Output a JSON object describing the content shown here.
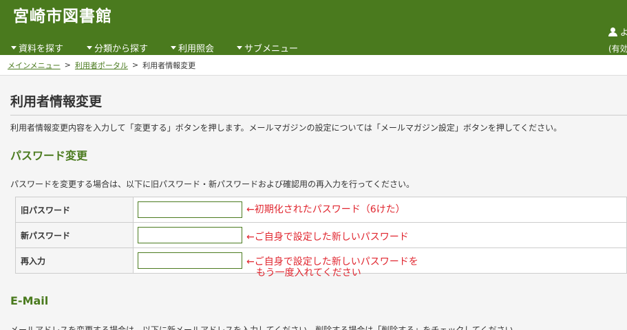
{
  "header": {
    "site_title": "宮崎市図書館",
    "user_name": "よ",
    "user_status": "(有効",
    "nav": [
      {
        "label": "資料を探す"
      },
      {
        "label": "分類から探す"
      },
      {
        "label": "利用照会"
      },
      {
        "label": "サブメニュー"
      }
    ]
  },
  "breadcrumb": {
    "items": [
      {
        "label": "メインメニュー"
      },
      {
        "label": "利用者ポータル"
      },
      {
        "label": "利用者情報変更"
      }
    ],
    "separator": ">"
  },
  "main": {
    "title": "利用者情報変更",
    "intro": "利用者情報変更内容を入力して「変更する」ボタンを押します。メールマガジンの設定については「メールマガジン設定」ボタンを押してください。",
    "password_section": {
      "heading": "パスワード変更",
      "description": "パスワードを変更する場合は、以下に旧パスワード・新パスワードおよび確認用の再入力を行ってください。",
      "rows": [
        {
          "label": "旧パスワード",
          "value": "",
          "note": "←初期化されたパスワード（6けた）"
        },
        {
          "label": "新パスワード",
          "value": "",
          "note": "←ご自身で設定した新しいパスワード"
        },
        {
          "label": "再入力",
          "value": "",
          "note": "←ご自身で設定した新しいパスワードを",
          "note_line2": "もう一度入れてください"
        }
      ]
    },
    "email_section": {
      "heading": "E-Mail",
      "description": "メールアドレスを変更する場合は、以下に新メールアドレスを入力してください。削除する場合は「削除する」をチェックしてください。"
    }
  },
  "colors": {
    "brand_green": "#4a7a1e",
    "annotation_red": "#e0262f"
  }
}
